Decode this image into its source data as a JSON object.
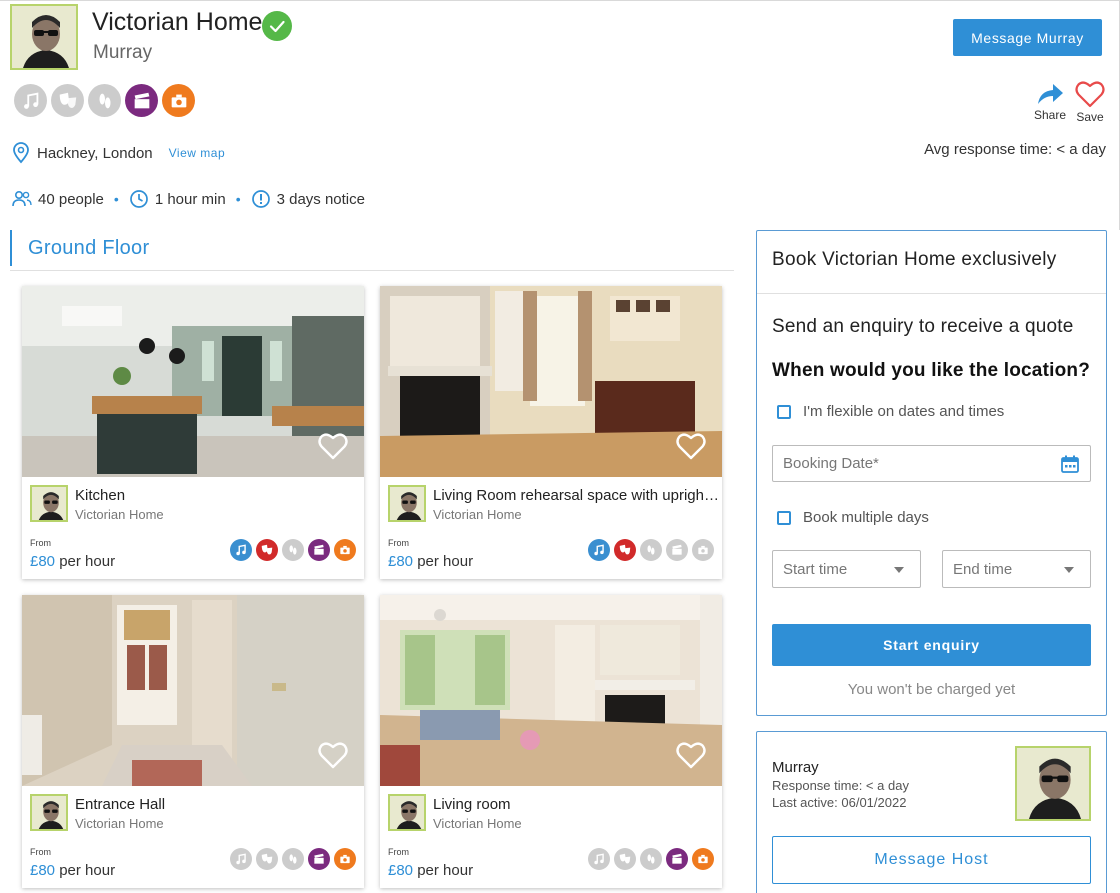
{
  "listing": {
    "title": "Victorian Home",
    "host_name": "Murray",
    "message_button": "Message Murray",
    "location": "Hackney, London",
    "view_map": "View map",
    "avg_response": "Avg response time: < a day",
    "share_label": "Share",
    "save_label": "Save",
    "stats": {
      "capacity": "40 people",
      "min_hours": "1 hour min",
      "notice": "3 days notice"
    },
    "activities": [
      {
        "icon": "music-icon",
        "active": false,
        "color": "#cccccc"
      },
      {
        "icon": "theatre-masks-icon",
        "active": false,
        "color": "#cccccc"
      },
      {
        "icon": "dance-shoes-icon",
        "active": false,
        "color": "#cccccc"
      },
      {
        "icon": "clapperboard-icon",
        "active": true,
        "color": "#7b2a7f"
      },
      {
        "icon": "photo-camera-icon",
        "active": true,
        "color": "#ef7a1e"
      }
    ]
  },
  "section": {
    "title": "Ground Floor"
  },
  "rooms": [
    {
      "title": "Kitchen",
      "subtitle": "Victorian Home",
      "from": "From",
      "price": "£80",
      "unit": " per hour",
      "activity_colors": [
        "#3a8fd0",
        "#d12a2a",
        "#cccccc",
        "#7b2a7f",
        "#ef7a1e"
      ]
    },
    {
      "title": "Living Room rehearsal space with upright piano",
      "subtitle": "Victorian Home",
      "from": "From",
      "price": "£80",
      "unit": " per hour",
      "activity_colors": [
        "#3a8fd0",
        "#d12a2a",
        "#cccccc",
        "#cccccc",
        "#cccccc"
      ]
    },
    {
      "title": "Entrance Hall",
      "subtitle": "Victorian Home",
      "from": "From",
      "price": "£80",
      "unit": " per hour",
      "activity_colors": [
        "#cccccc",
        "#cccccc",
        "#cccccc",
        "#7b2a7f",
        "#ef7a1e"
      ]
    },
    {
      "title": "Living room",
      "subtitle": "Victorian Home",
      "from": "From",
      "price": "£80",
      "unit": " per hour",
      "activity_colors": [
        "#cccccc",
        "#cccccc",
        "#cccccc",
        "#7b2a7f",
        "#ef7a1e"
      ]
    }
  ],
  "booking": {
    "heading": "Book Victorian Home exclusively",
    "subheading": "Send an enquiry to receive a quote",
    "question": "When would you like the location?",
    "flexible_label": "I'm flexible on dates and times",
    "date_placeholder": "Booking Date*",
    "multiple_label": "Book multiple days",
    "start_time_placeholder": "Start time",
    "end_time_placeholder": "End time",
    "submit_label": "Start enquiry",
    "note": "You won't be charged yet"
  },
  "host": {
    "name": "Murray",
    "response": "Response time: < a day",
    "last_active": "Last active: 06/01/2022",
    "message_label": "Message Host"
  },
  "colors": {
    "accent": "#2f8fd6",
    "verified": "#55b848",
    "heart": "#e84a4a"
  }
}
